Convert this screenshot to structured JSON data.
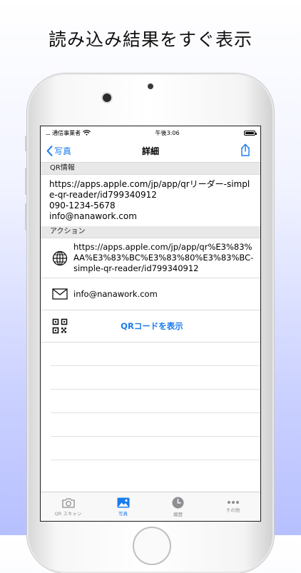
{
  "headline": "読み込み結果をすぐ表示",
  "status": {
    "carrier": "通信事業者",
    "time": "午後3:06"
  },
  "nav": {
    "back_label": "写真",
    "title": "詳細"
  },
  "qr_section": {
    "header": "QR情報",
    "lines": [
      "https://apps.apple.com/jp/app/qrリーダー-simple-qr-reader/id799340912",
      "090-1234-5678",
      "info@nanawork.com"
    ]
  },
  "action_section": {
    "header": "アクション",
    "link": "https://apps.apple.com/jp/app/qr%E3%83%AA%E3%83%BC%E3%83%80%E3%83%BC-simple-qr-reader/id799340912",
    "email": "info@nanawork.com",
    "show_qr": "QRコードを表示"
  },
  "tabs": [
    {
      "label": "QR スキャン",
      "icon": "camera-icon"
    },
    {
      "label": "写真",
      "icon": "photo-icon"
    },
    {
      "label": "履歴",
      "icon": "clock-icon"
    },
    {
      "label": "その他",
      "icon": "more-icon"
    }
  ],
  "colors": {
    "accent": "#1a7bf0",
    "section_bg": "#e8e8e8"
  }
}
